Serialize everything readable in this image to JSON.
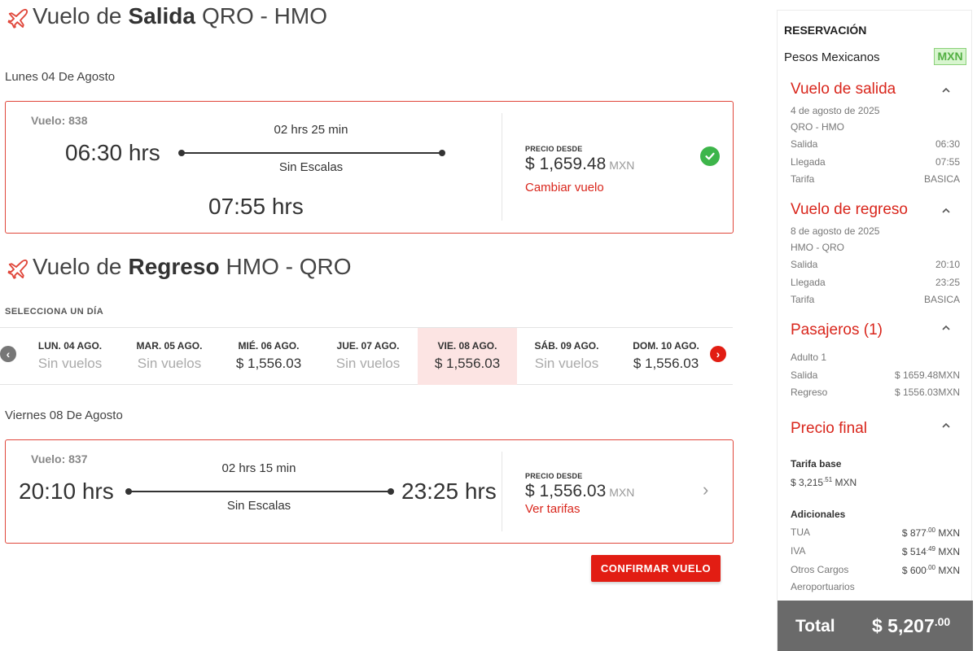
{
  "outbound": {
    "title_prefix": "Vuelo de",
    "title_bold": "Salida",
    "title_route": "QRO - HMO",
    "date": "Lunes 04 De Agosto",
    "flight_number": "Vuelo: 838",
    "depart_time": "06:30 hrs",
    "arrive_time": "07:55 hrs",
    "duration": "02 hrs 25 min",
    "stops": "Sin Escalas",
    "price_label": "PRECIO DESDE",
    "price": "$ 1,659.48",
    "currency": "MXN",
    "action": "Cambiar vuelo",
    "selected": true
  },
  "return": {
    "title_prefix": "Vuelo de",
    "title_bold": "Regreso",
    "title_route": "HMO - QRO",
    "select_label": "SELECCIONA UN DÍA",
    "days": [
      {
        "name": "LUN. 04 AGO.",
        "price": "Sin vuelos",
        "available": false
      },
      {
        "name": "MAR. 05 AGO.",
        "price": "Sin vuelos",
        "available": false
      },
      {
        "name": "MIÉ. 06 AGO.",
        "price": "$ 1,556.03",
        "available": true
      },
      {
        "name": "JUE. 07 AGO.",
        "price": "Sin vuelos",
        "available": false
      },
      {
        "name": "VIE. 08 AGO.",
        "price": "$ 1,556.03",
        "available": true,
        "selected": true
      },
      {
        "name": "SÁB. 09 AGO.",
        "price": "Sin vuelos",
        "available": false
      },
      {
        "name": "DOM. 10 AGO.",
        "price": "$ 1,556.03",
        "available": true
      }
    ],
    "date": "Viernes 08 De Agosto",
    "flight_number": "Vuelo: 837",
    "depart_time": "20:10 hrs",
    "arrive_time": "23:25 hrs",
    "duration": "02 hrs 15 min",
    "stops": "Sin Escalas",
    "price_label": "PRECIO DESDE",
    "price": "$ 1,556.03",
    "currency": "MXN",
    "action": "Ver tarifas"
  },
  "confirm_label": "CONFIRMAR VUELO",
  "sidebar": {
    "title": "RESERVACIÓN",
    "currency_name": "Pesos Mexicanos",
    "currency_code": "MXN",
    "outbound": {
      "heading": "Vuelo de salida",
      "date": "4 de agosto de 2025",
      "route": "QRO - HMO",
      "rows": [
        {
          "label": "Salida",
          "value": "06:30"
        },
        {
          "label": "Llegada",
          "value": "07:55"
        },
        {
          "label": "Tarifa",
          "value": "BASICA"
        }
      ]
    },
    "return": {
      "heading": "Vuelo de regreso",
      "date": "8 de agosto de 2025",
      "route": "HMO - QRO",
      "rows": [
        {
          "label": "Salida",
          "value": "20:10"
        },
        {
          "label": "Llegada",
          "value": "23:25"
        },
        {
          "label": "Tarifa",
          "value": "BASICA"
        }
      ]
    },
    "passengers": {
      "heading": "Pasajeros (1)",
      "type": "Adulto 1",
      "rows": [
        {
          "label": "Salida",
          "value": "$ 1659.48MXN"
        },
        {
          "label": "Regreso",
          "value": "$ 1556.03MXN"
        }
      ]
    },
    "final": {
      "heading": "Precio final",
      "base_label": "Tarifa base",
      "base_int": "$ 3,215",
      "base_dec": ".51",
      "base_cur": "MXN",
      "extras_label": "Adicionales",
      "extras": [
        {
          "label": "TUA",
          "int": "$ 877",
          "dec": ".00",
          "cur": "MXN"
        },
        {
          "label": "IVA",
          "int": "$ 514",
          "dec": ".49",
          "cur": "MXN"
        },
        {
          "label": "Otros Cargos",
          "label2": "Aeroportuarios",
          "int": "$ 600",
          "dec": ".00",
          "cur": "MXN"
        }
      ]
    },
    "total_label": "Total",
    "total_int": "$ 5,207",
    "total_dec": ".00"
  },
  "colors": {
    "accent": "#e21d13",
    "check": "#3db54a",
    "selected_day": "#fce4e3",
    "total_bg": "#6a6a6a"
  }
}
